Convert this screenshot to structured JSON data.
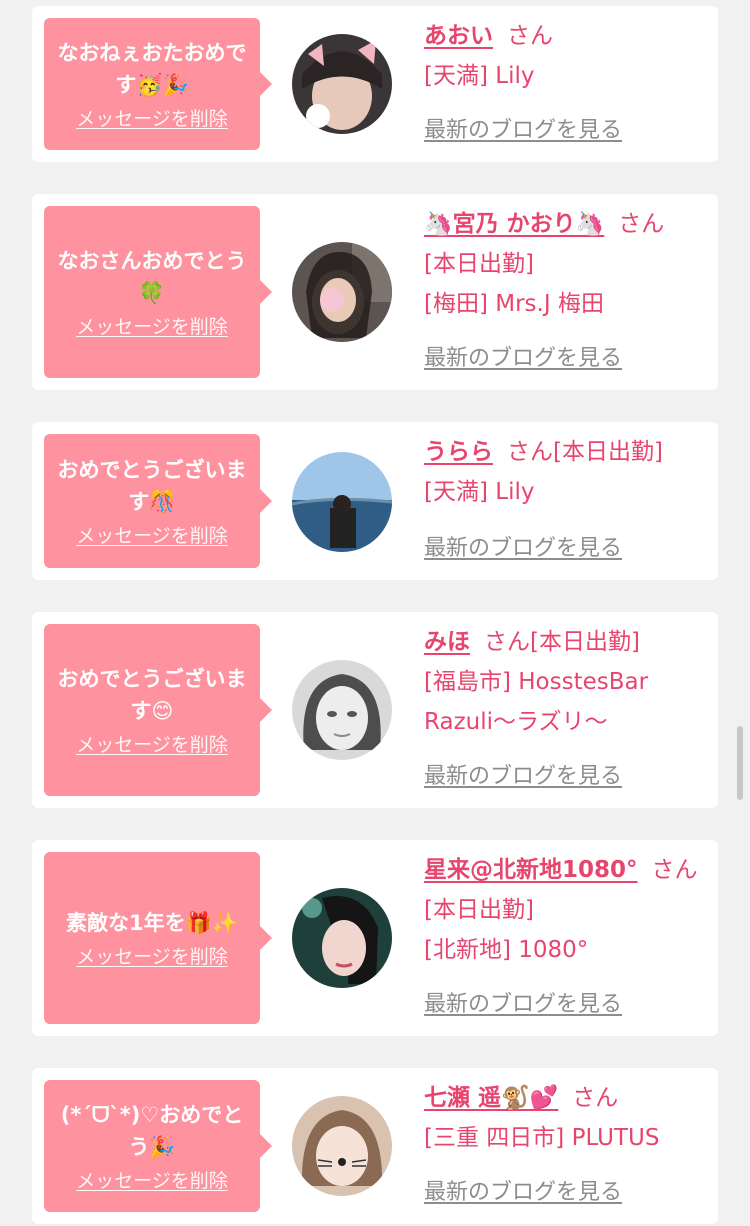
{
  "delete_label": "メッセージを削除",
  "blog_label": "最新のブログを見る",
  "colors": {
    "bubble": "#ff929f",
    "accent": "#e8456e",
    "muted": "#8d8d8d",
    "background": "#f1f1f1"
  },
  "messages": [
    {
      "message": "なおねぇおたおめです🥳🎉",
      "name": "あおい",
      "honorific": "さん",
      "status": "",
      "shop": "[天満] Lily",
      "avatar_icon": "avatar-photo"
    },
    {
      "message": "なおさんおめでとう🍀",
      "name": "🦄宮乃 かおり🦄",
      "honorific": "さん",
      "status": "[本日出勤]",
      "shop": "[梅田] Mrs.J 梅田",
      "avatar_icon": "avatar-photo"
    },
    {
      "message": "おめでとうございます🎊",
      "name": "うらら",
      "honorific": "さん",
      "status": "[本日出勤]",
      "shop": "[天満] Lily",
      "avatar_icon": "avatar-photo"
    },
    {
      "message": "おめでとうございます😊",
      "name": "みほ",
      "honorific": "さん",
      "status": "[本日出勤]",
      "shop": "[福島市] HosstesBar Razuli〜ラズリ〜",
      "avatar_icon": "avatar-photo"
    },
    {
      "message": "素敵な1年を🎁✨",
      "name": "星来@北新地1080°",
      "honorific": "さん",
      "status": "[本日出勤]",
      "shop": "[北新地] 1080°",
      "avatar_icon": "avatar-photo"
    },
    {
      "message": "(*´ᗜ`*)♡おめでとう🎉",
      "name": "七瀬 遥🐒💕",
      "honorific": "さん",
      "status": "",
      "shop": "[三重 四日市] PLUTUS",
      "avatar_icon": "avatar-photo"
    }
  ]
}
